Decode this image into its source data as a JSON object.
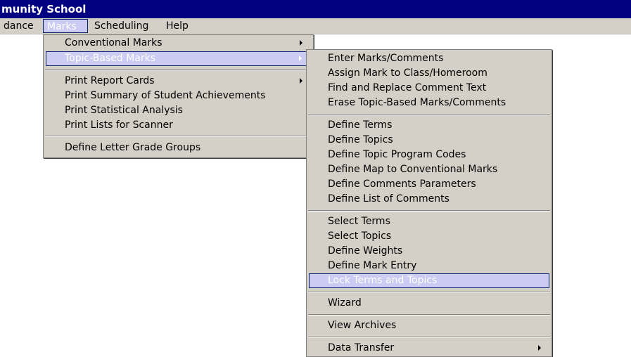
{
  "window": {
    "title": "munity School"
  },
  "menubar": {
    "items": [
      {
        "label": "dance",
        "active": false
      },
      {
        "label": "Marks",
        "active": true
      },
      {
        "label": "Scheduling",
        "active": false
      },
      {
        "label": "Help",
        "active": false
      }
    ]
  },
  "marks_menu": {
    "items": [
      {
        "label": "Conventional Marks",
        "submenu": true
      },
      {
        "label": "Topic-Based Marks",
        "submenu": true,
        "highlighted": true
      },
      {
        "label": "Print Report Cards",
        "submenu": true
      },
      {
        "label": "Print Summary of Student Achievements"
      },
      {
        "label": "Print Statistical Analysis"
      },
      {
        "label": "Print Lists for Scanner"
      },
      {
        "label": "Define Letter Grade Groups"
      }
    ]
  },
  "topic_menu": {
    "items": [
      {
        "label": "Enter Marks/Comments"
      },
      {
        "label": "Assign Mark to Class/Homeroom"
      },
      {
        "label": "Find and Replace Comment Text"
      },
      {
        "label": "Erase Topic-Based Marks/Comments"
      },
      {
        "label": "Define Terms"
      },
      {
        "label": "Define Topics"
      },
      {
        "label": "Define Topic Program Codes"
      },
      {
        "label": "Define Map to Conventional Marks"
      },
      {
        "label": "Define Comments Parameters"
      },
      {
        "label": "Define List of Comments"
      },
      {
        "label": "Select Terms"
      },
      {
        "label": "Select Topics"
      },
      {
        "label": "Define Weights"
      },
      {
        "label": "Define Mark Entry"
      },
      {
        "label": "Lock Terms and Topics",
        "highlighted": true
      },
      {
        "label": "Wizard"
      },
      {
        "label": "View Archives"
      },
      {
        "label": "Data Transfer",
        "submenu": true
      }
    ]
  },
  "colors": {
    "titlebar": "#000080",
    "menu_face": "#d4d0c8",
    "highlight": "#cbcbf3",
    "highlight_border": "#0a246a"
  },
  "icons": {
    "submenu_indicator": "submenu-arrow-icon"
  }
}
